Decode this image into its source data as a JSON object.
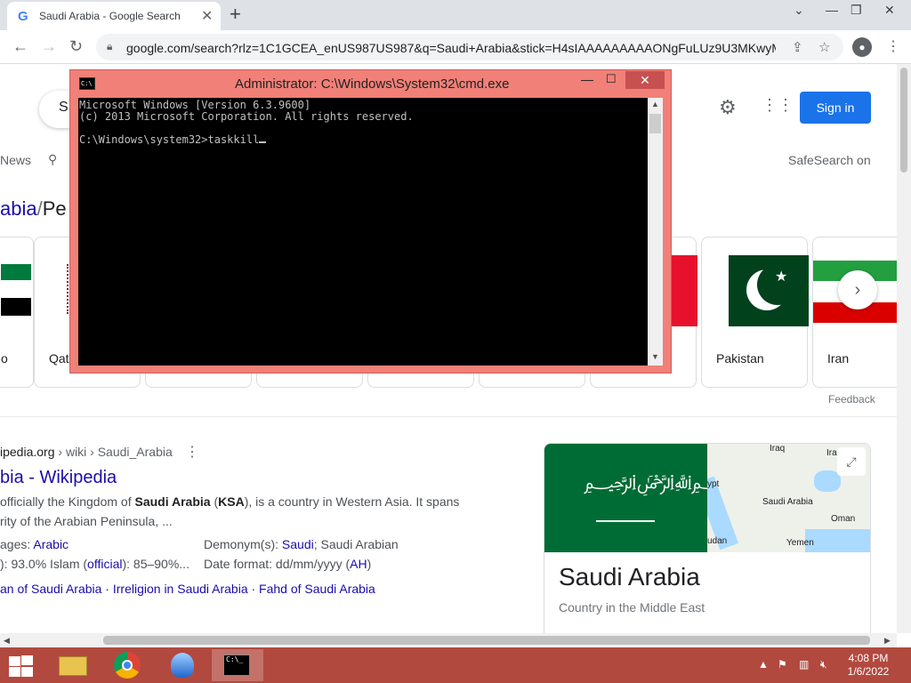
{
  "browser": {
    "tab_favicon": "G",
    "tab_title": "Saudi Arabia - Google Search",
    "tab_close": "✕",
    "new_tab": "+",
    "url": "google.com/search?rlz=1C1GCEA_enUS987US987&q=Saudi+Arabia&stick=H4sIAAAAAAAAAONgFuLUz9U3MKwyMj..."
  },
  "google": {
    "search_text": "S",
    "sign_in": "Sign in",
    "tab_news": "News",
    "safesearch": "SafeSearch on",
    "breadcrumb_prefix": "abia",
    "breadcrumb_sep": "/",
    "breadcrumb_current": "Pe",
    "carousel": {
      "qatar_label": "Qat",
      "o_label": "o",
      "pakistan_label": "Pakistan",
      "iran_label": "Iran"
    },
    "feedback": "Feedback",
    "result": {
      "cite_domain": "ipedia.org",
      "cite_path": " › wiki › Saudi_Arabia",
      "title": "bia - Wikipedia",
      "snippet_1a": " officially the Kingdom of ",
      "snippet_1b": "Saudi Arabia",
      "snippet_1c": " (",
      "snippet_1d": "KSA",
      "snippet_1e": "), is a country in Western Asia. It spans",
      "snippet_2": "rity of the Arabian Peninsula, ...",
      "lang_label": "ages: ",
      "lang_value": "Arabic",
      "rel_label": "): 93.0% Islam (",
      "rel_link": "official",
      "rel_rest": "): 85–90%...",
      "demonym_label": "Demonym(s): ",
      "demonym_link": "Saudi",
      "demonym_rest": "; Saudi Arabian",
      "date_label": "Date format: dd/mm/yyyy (",
      "date_link": "AH",
      "date_rest": ")",
      "related": "an of Saudi Arabia · Irreligion in Saudi Arabia · Fahd of Saudi Arabia"
    },
    "knowledge_panel": {
      "title": "Saudi Arabia",
      "subtitle": "Country in the Middle East",
      "map_labels": [
        "Iraq",
        "Ira",
        "ypt",
        "Saudi Arabia",
        "Oman",
        "udan",
        "Yemen"
      ]
    }
  },
  "cmd": {
    "title": "Administrator: C:\\Windows\\System32\\cmd.exe",
    "line1": "Microsoft Windows [Version 6.3.9600]",
    "line2": "(c) 2013 Microsoft Corporation. All rights reserved.",
    "line3": "",
    "prompt": "C:\\Windows\\system32>taskkill",
    "minimize": "—",
    "maximize": "☐",
    "close": "✕"
  },
  "taskbar": {
    "time": "4:08 PM",
    "date": "1/6/2022"
  },
  "icons": [
    "google-favicon",
    "back-arrow-icon",
    "forward-arrow-icon",
    "reload-icon",
    "lock-icon",
    "share-icon",
    "star-icon",
    "profile-icon",
    "kebab-menu-icon",
    "settings-gear-icon",
    "apps-grid-icon",
    "location-pin-icon",
    "chevron-right-icon",
    "expand-icon",
    "cmd-icon",
    "windows-start-icon",
    "file-explorer-icon",
    "chrome-icon",
    "flag-tray-icon",
    "network-icon",
    "volume-muted-icon"
  ],
  "colors": {
    "cmd_frame": "#f08078",
    "taskbar": "#b2493f",
    "sign_in_button": "#1a73e8",
    "link": "#1a0dab"
  }
}
